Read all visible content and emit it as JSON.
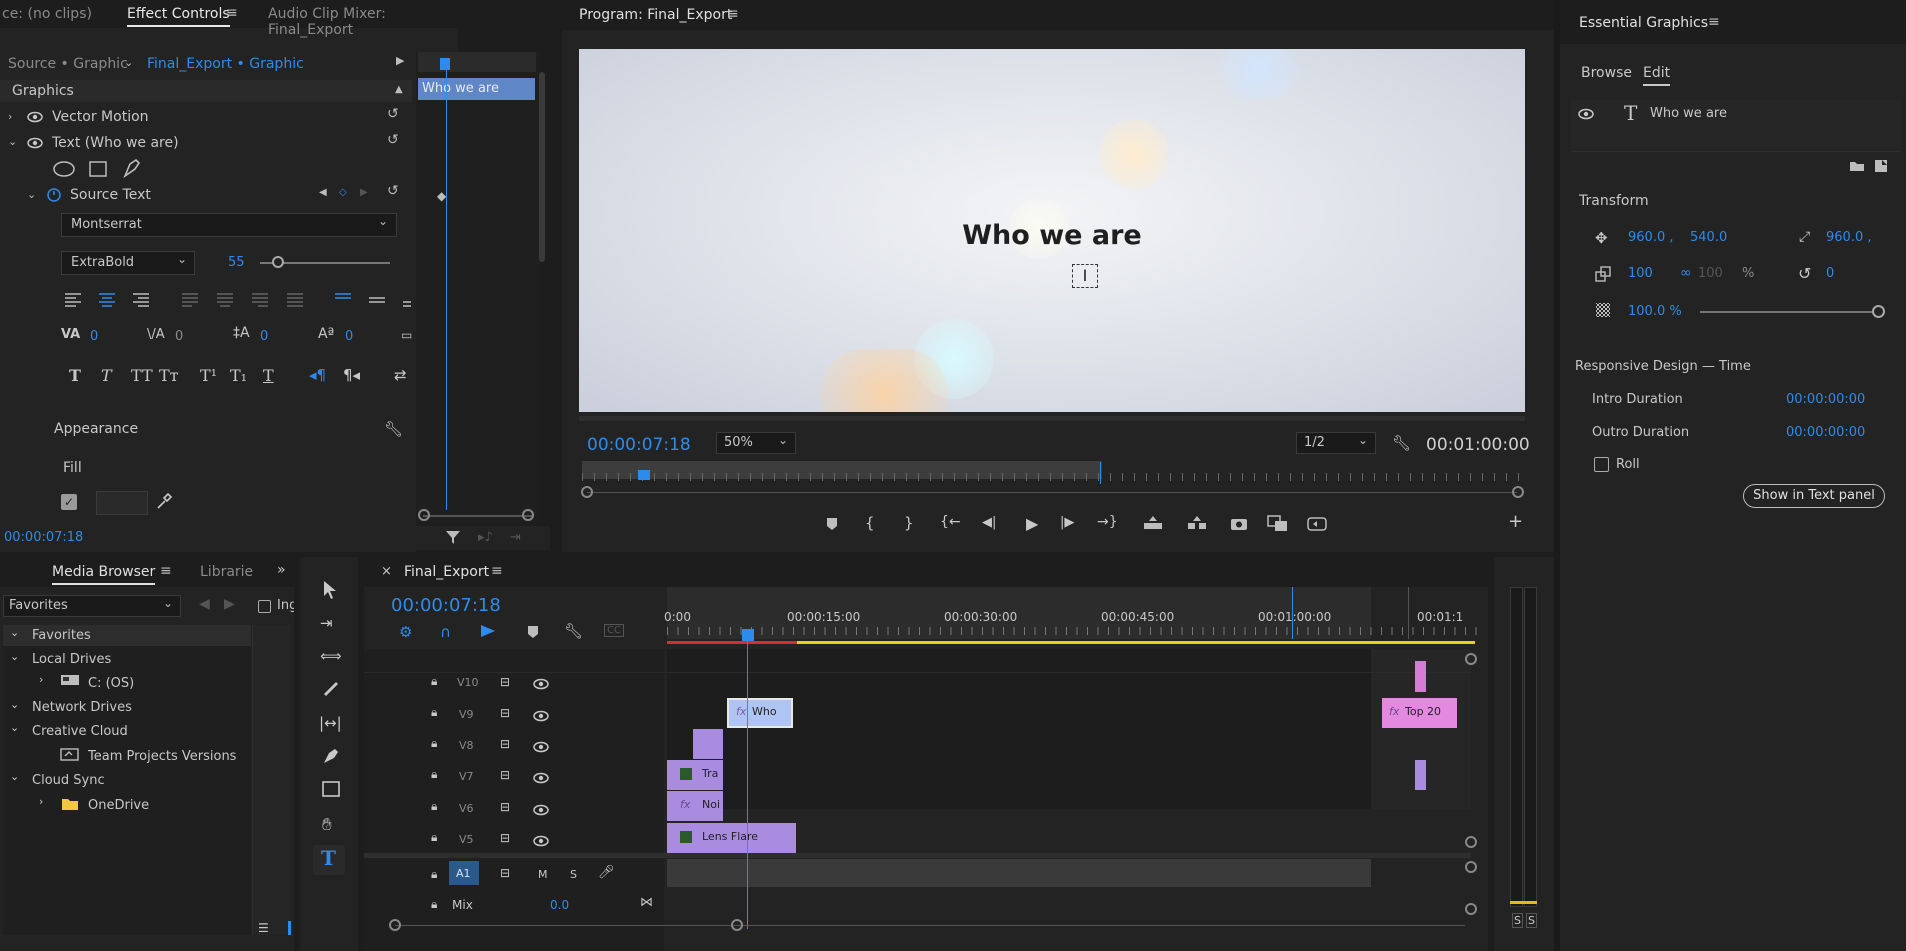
{
  "effect_controls": {
    "tab_source_none": "ce: (no clips)",
    "tab_effect_controls": "Effect Controls",
    "tab_audio_mixer": "Audio Clip Mixer: Final_Export",
    "subtab_source": "Source • Graphic",
    "subtab_sequence": "Final_Export • Graphic",
    "section_graphics": "Graphics",
    "vector_motion": "Vector Motion",
    "text_layer": "Text (Who we are)",
    "source_text": "Source Text",
    "font": "Montserrat",
    "font_style": "ExtraBold",
    "font_size": "55",
    "tracking": "0",
    "kerning": "0",
    "leading": "0",
    "baseline": "0",
    "appearance": "Appearance",
    "fill": "Fill",
    "mini_clip": "Who we are",
    "timecode": "00:00:07:18"
  },
  "program": {
    "title": "Program: Final_Export",
    "overlay_text": "Who we are",
    "timecode": "00:00:07:18",
    "zoom": "50%",
    "resolution": "1/2",
    "duration": "00:01:00:00",
    "playhead_fraction": 0.07
  },
  "essential_graphics": {
    "title": "Essential Graphics",
    "tab_browse": "Browse",
    "tab_edit": "Edit",
    "layer": "Who we are",
    "transform": "Transform",
    "pos_x": "960.0 ,",
    "pos_y": "540.0",
    "anchor_x": "960.0 ,",
    "scale": "100",
    "scale_h": "100",
    "percent": "%",
    "rotation": "0",
    "opacity": "100.0 %",
    "responsive": "Responsive Design — Time",
    "intro_label": "Intro Duration",
    "intro_value": "00:00:00:00",
    "outro_label": "Outro Duration",
    "outro_value": "00:00:00:00",
    "roll": "Roll",
    "show_text_panel": "Show in Text panel"
  },
  "media_browser": {
    "tab": "Media Browser",
    "tab2": "Librarie",
    "dropdown": "Favorites",
    "ingest": "Ing",
    "tree": [
      {
        "label": "Favorites",
        "level": 0
      },
      {
        "label": "Local Drives",
        "level": 0
      },
      {
        "label": "C: (OS)",
        "level": 1
      },
      {
        "label": "Network Drives",
        "level": 0
      },
      {
        "label": "Creative Cloud",
        "level": 0
      },
      {
        "label": "Team Projects Versions",
        "level": 1
      },
      {
        "label": "Cloud Sync",
        "level": 0
      },
      {
        "label": "OneDrive",
        "level": 1
      }
    ]
  },
  "timeline": {
    "title": "Final_Export",
    "timecode": "00:00:07:18",
    "ruler": [
      "0:00",
      "00:00:15:00",
      "00:00:30:00",
      "00:00:45:00",
      "00:01:00:00",
      "00:01:1"
    ],
    "tracks": [
      "V10",
      "V9",
      "V8",
      "V7",
      "V6",
      "V5"
    ],
    "audio_track": "A1",
    "mix_label": "Mix",
    "mix_value": "0.0",
    "m": "M",
    "s": "S",
    "clips": {
      "who": "Who",
      "top": "Top 20",
      "tra": "Tra",
      "noi": "Noi",
      "lens": "Lens Flare"
    }
  },
  "meter": {
    "s1": "S",
    "s2": "S"
  },
  "colors": {
    "accent": "#2d8ceb",
    "pink": "#d97ad6",
    "purple": "#a98ce0",
    "yellow": "#e6d21e",
    "red": "#d03030"
  }
}
